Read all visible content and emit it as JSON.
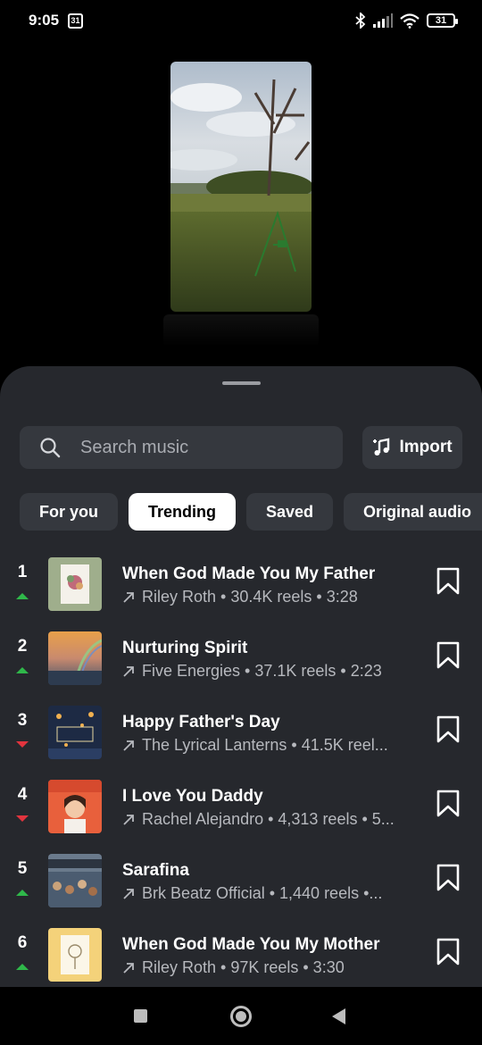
{
  "status_bar": {
    "time": "9:05",
    "calendar_day": "31",
    "battery": "31",
    "icons": [
      "bluetooth-icon",
      "signal-icon",
      "wifi-icon",
      "battery-icon"
    ]
  },
  "search": {
    "placeholder": "Search music",
    "icon": "search-icon"
  },
  "import_button": {
    "label": "Import",
    "icon": "music-note-plus-icon"
  },
  "tabs": [
    {
      "label": "For you",
      "active": false
    },
    {
      "label": "Trending",
      "active": true
    },
    {
      "label": "Saved",
      "active": false
    },
    {
      "label": "Original audio",
      "active": false
    }
  ],
  "tracks": [
    {
      "rank": "1",
      "trend": "up",
      "title": "When God Made You My Father",
      "meta": "Riley Roth • 30.4K reels • 3:28"
    },
    {
      "rank": "2",
      "trend": "up",
      "title": "Nurturing Spirit",
      "meta": "Five Energies • 37.1K reels • 2:23"
    },
    {
      "rank": "3",
      "trend": "down",
      "title": "Happy Father's Day",
      "meta": "The Lyrical Lanterns • 41.5K reel..."
    },
    {
      "rank": "4",
      "trend": "down",
      "title": "I Love You Daddy",
      "meta": "Rachel Alejandro • 4,313 reels • 5..."
    },
    {
      "rank": "5",
      "trend": "up",
      "title": "Sarafina",
      "meta": "Brk Beatz Official • 1,440 reels •..."
    },
    {
      "rank": "6",
      "trend": "up",
      "title": "When God Made You My Mother",
      "meta": "Riley Roth • 97K reels • 3:30"
    }
  ],
  "colors": {
    "sheet_bg": "#26282d",
    "chip_bg": "#35383e",
    "trend_up": "#2fb84a",
    "trend_down": "#e2343e"
  }
}
